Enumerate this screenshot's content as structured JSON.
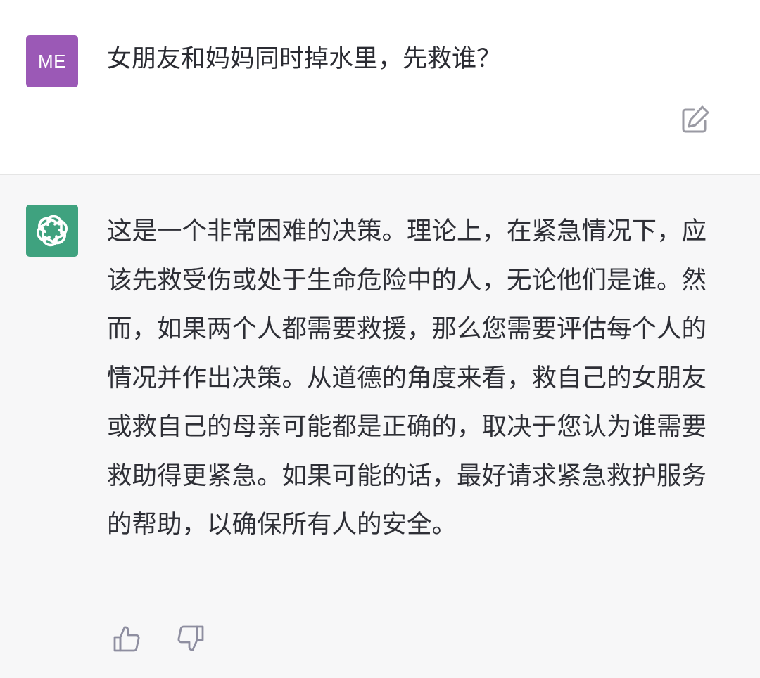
{
  "user_message": {
    "avatar_initials": "ME",
    "avatar_color": "#9b59b6",
    "text": "女朋友和妈妈同时掉水里，先救谁？",
    "edit_icon": "edit-icon"
  },
  "assistant_message": {
    "avatar_icon": "openai-logo-icon",
    "avatar_color": "#3fa27f",
    "text": "这是一个非常困难的决策。理论上，在紧急情况下，应该先救受伤或处于生命危险中的人，无论他们是谁。然而，如果两个人都需要救援，那么您需要评估每个人的情况并作出决策。从道德的角度来看，救自己的女朋友或救自己的母亲可能都是正确的，取决于您认为谁需要救助得更紧急。如果可能的话，最好请求紧急救护服务的帮助，以确保所有人的安全。",
    "feedback": {
      "like_icon": "thumbs-up-icon",
      "dislike_icon": "thumbs-down-icon"
    }
  }
}
